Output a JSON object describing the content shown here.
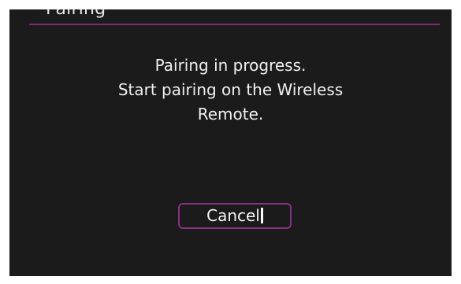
{
  "dialog": {
    "title": "Pairing",
    "message_lines": [
      "Pairing in progress.",
      "Start pairing on the Wireless",
      "Remote."
    ],
    "cancel_label": "Cancel"
  },
  "colors": {
    "background": "#1b1b1b",
    "accent": "#8a2e85",
    "text": "#f0f0f0"
  }
}
